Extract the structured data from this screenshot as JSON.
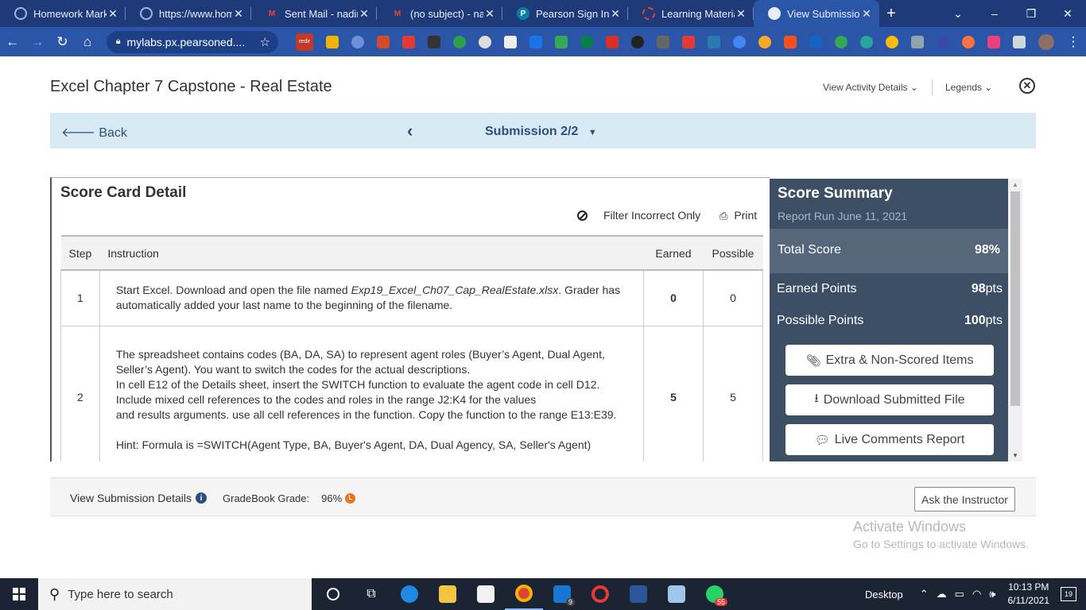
{
  "browser": {
    "tabs": [
      {
        "title": "Homework Marke",
        "color": "#2b56a7"
      },
      {
        "title": "https://www.hom",
        "color": "#2b56a7"
      },
      {
        "title": "Sent Mail - nadirh",
        "color": "#d93025"
      },
      {
        "title": "(no subject) - nad",
        "color": "#d93025"
      },
      {
        "title": "Pearson Sign In",
        "color": "#0a7ca8"
      },
      {
        "title": "Learning Material",
        "color": "#d93025"
      },
      {
        "title": "View Submission",
        "color": "#ffffff"
      }
    ],
    "url": "mylabs.px.pearsoned....",
    "ext_label": "redir"
  },
  "header": {
    "title": "Excel Chapter 7 Capstone - Real Estate",
    "view_activity": "View Activity Details",
    "legends": "Legends"
  },
  "subbar": {
    "back": "Back",
    "submission": "Submission 2/2"
  },
  "scorecard": {
    "title": "Score Card Detail",
    "filter": "Filter Incorrect Only",
    "print": "Print",
    "columns": {
      "step": "Step",
      "instruction": "Instruction",
      "earned": "Earned",
      "possible": "Possible"
    },
    "rows": [
      {
        "step": "1",
        "pre": "Start Excel. Download and open the file named ",
        "file": "Exp19_Excel_Ch07_Cap_RealEstate.xlsx",
        "post": ". Grader has automatically added your last name to the beginning of the filename.",
        "earned": "0",
        "possible": "0"
      },
      {
        "step": "2",
        "line1": "The spreadsheet contains codes (BA, DA, SA) to represent agent roles (Buyer’s Agent, Dual Agent, Seller’s Agent). You want to switch the codes for the actual descriptions.",
        "line2": "In cell E12 of the Details sheet, insert the SWITCH function to evaluate the agent code in cell D12.",
        "line3": "Include mixed cell references to the codes and roles in the range J2:K4 for the values",
        "line4": "and results arguments. use all cell references in the function. Copy the function to the range E13:E39.",
        "hint": "Hint: Formula is =SWITCH(Agent Type, BA, Buyer's Agent, DA, Dual Agency, SA, Seller's Agent)",
        "earned": "5",
        "possible": "5"
      }
    ]
  },
  "summary": {
    "title": "Score Summary",
    "report_run": "Report Run June 11, 2021",
    "total_label": "Total Score",
    "total_value": "98%",
    "earned_label": "Earned Points",
    "earned_value": "98",
    "possible_label": "Possible Points",
    "possible_value": "100",
    "pts_unit": "pts",
    "btn_extra": "Extra & Non-Scored Items",
    "btn_download": "Download Submitted File",
    "btn_comments": "Live Comments Report"
  },
  "footer": {
    "view_details": "View Submission Details",
    "gradebook_label": "GradeBook Grade:",
    "gradebook_value": "96%",
    "ask": "Ask the Instructor"
  },
  "watermark": {
    "line1": "Activate Windows",
    "line2": "Go to Settings to activate Windows."
  },
  "taskbar": {
    "search": "Type here to search",
    "desktop": "Desktop",
    "time": "10:13 PM",
    "date": "6/11/2021",
    "mail_badge": "9",
    "whatsapp_badge": "55",
    "notif_count": "19"
  }
}
